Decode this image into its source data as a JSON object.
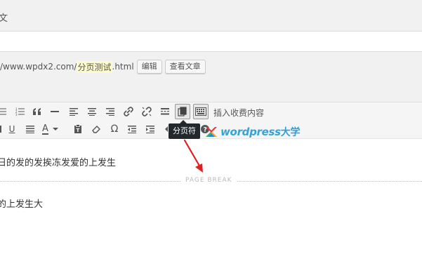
{
  "header": {
    "title_tail": "文"
  },
  "permalink": {
    "prefix": "/www.wpdx2.com/",
    "slug": "分页测试",
    "suffix": ".html",
    "edit_button": "编辑",
    "view_button": "查看文章"
  },
  "toolbar": {
    "row1_icons": [
      "bullet-list-icon",
      "numbered-list-icon",
      "blockquote-icon",
      "horizontal-line-icon",
      "align-left-icon",
      "align-center-icon",
      "align-right-icon",
      "link-icon",
      "unlink-icon",
      "read-more-icon",
      "page-break-icon",
      "toolbar-toggle-icon"
    ],
    "row2_icons": [
      "underline-icon",
      "justify-icon",
      "text-color-icon",
      "paste-as-text-icon",
      "clear-formatting-icon",
      "special-character-icon",
      "outdent-icon",
      "indent-icon",
      "undo-icon",
      "help-icon"
    ],
    "insert_paid_content": "插入收费内容",
    "underline_label": "U",
    "text_color_label": "A",
    "omega_label": "Ω"
  },
  "tooltip": {
    "text": "分页符"
  },
  "watermark": {
    "latin": "wordpress",
    "cn": "大学"
  },
  "content": {
    "paragraph1": "日的发的发挨冻发爱的上发生",
    "page_break_label": "PAGE BREAK",
    "paragraph2": "的上发生大"
  },
  "colors": {
    "accent_red": "#e02020",
    "brand_blue": "#2a9fd8",
    "tooltip_bg": "#23282d"
  }
}
